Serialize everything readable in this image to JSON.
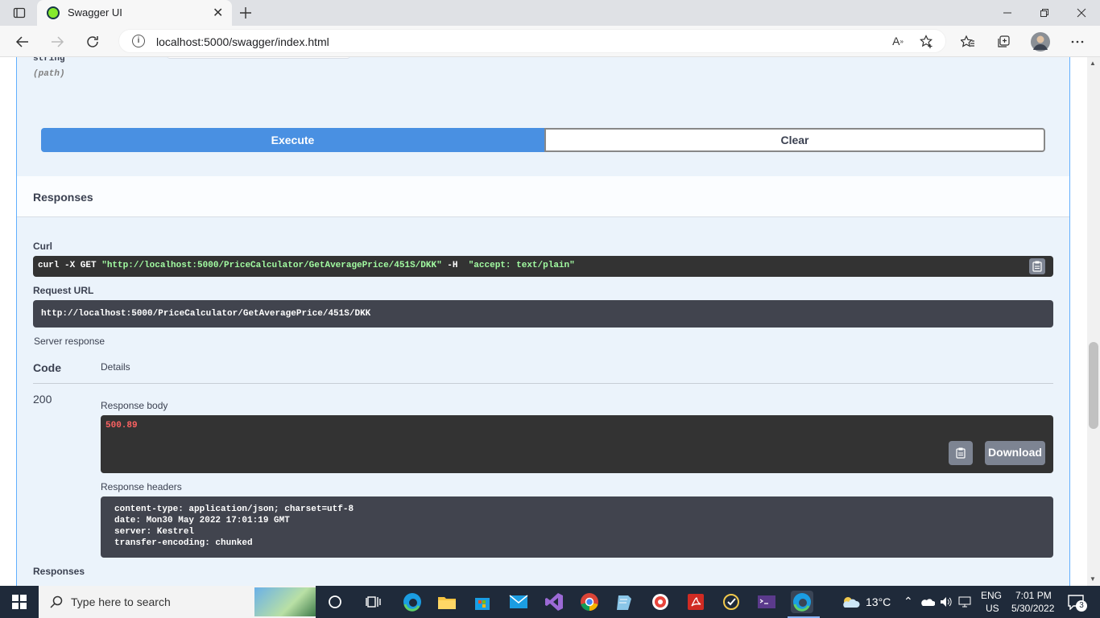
{
  "browser": {
    "tab_title": "Swagger UI",
    "url": "localhost:5000/swagger/index.html"
  },
  "param": {
    "type": "string",
    "location": "(path)"
  },
  "actions": {
    "execute_label": "Execute",
    "clear_label": "Clear"
  },
  "responses": {
    "section_title": "Responses",
    "curl_label": "Curl",
    "curl_prefix": "curl -X GET ",
    "curl_url": "\"http://localhost:5000/PriceCalculator/GetAveragePrice/451S/DKK\"",
    "curl_flag": " -H  ",
    "curl_header": "\"accept: text/plain\"",
    "request_url_label": "Request URL",
    "request_url": "http://localhost:5000/PriceCalculator/GetAveragePrice/451S/DKK",
    "server_response_label": "Server response",
    "code_header": "Code",
    "details_header": "Details",
    "code": "200",
    "response_body_label": "Response body",
    "response_body": "500.89",
    "download_label": "Download",
    "response_headers_label": "Response headers",
    "headers": [
      "content-type: application/json; charset=utf-8",
      "date: Mon30 May 2022 17:01:19 GMT",
      "server: Kestrel",
      "transfer-encoding: chunked"
    ],
    "footer_label": "Responses"
  },
  "taskbar": {
    "search_placeholder": "Type here to search",
    "weather": "13°C",
    "lang_top": "ENG",
    "lang_bottom": "US",
    "time": "7:01 PM",
    "date": "5/30/2022",
    "notification_count": "3"
  }
}
